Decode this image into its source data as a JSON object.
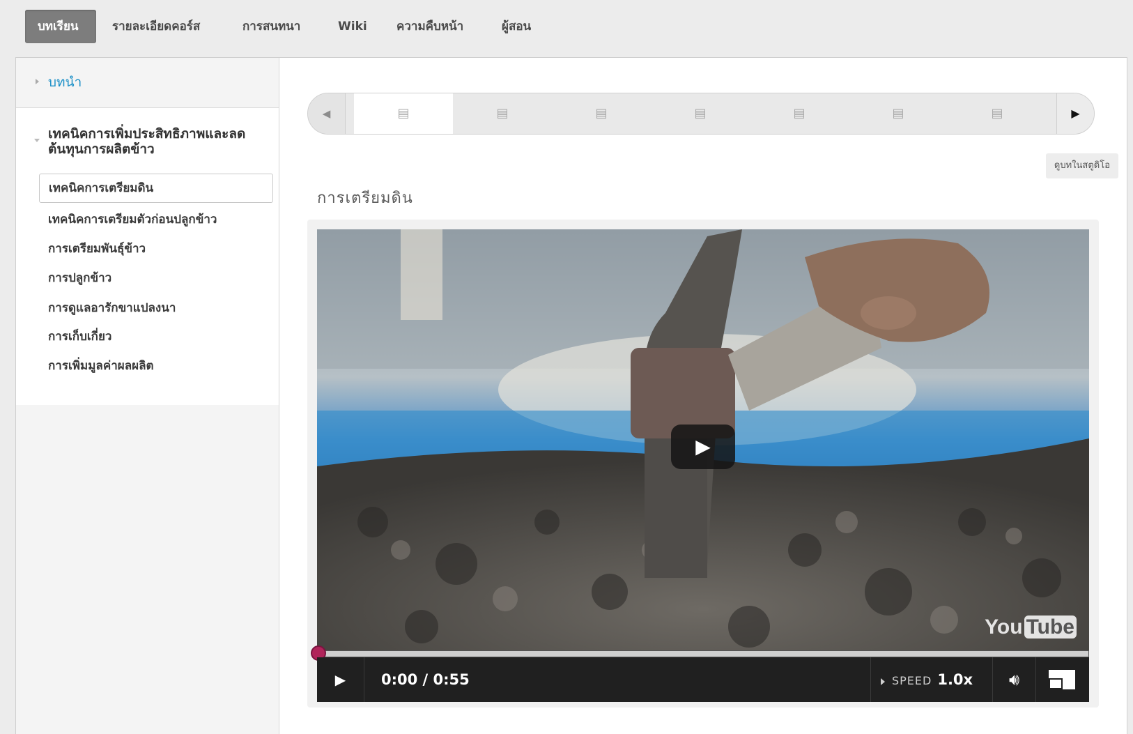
{
  "topnav": {
    "tabs": [
      {
        "label": "บทเรียน"
      },
      {
        "label": "รายละเอียดคอร์ส"
      },
      {
        "label": "การสนทนา"
      },
      {
        "label": "Wiki"
      },
      {
        "label": "ความคืบหน้า"
      },
      {
        "label": "ผู้สอน"
      }
    ],
    "active_index": 0
  },
  "sidebar": {
    "chapters": [
      {
        "label": "บทนำ",
        "expanded": false
      },
      {
        "label": "เทคนิคการเพิ่มประสิทธิภาพและลดต้นทุนการผลิตข้าว",
        "expanded": true
      }
    ],
    "lessons": [
      {
        "label": "เทคนิคการเตรียมดิน",
        "active": true
      },
      {
        "label": "เทคนิคการเตรียมตัวก่อนปลูกข้าว"
      },
      {
        "label": "การเตรียมพันธุ์ข้าว"
      },
      {
        "label": "การปลูกข้าว"
      },
      {
        "label": "การดูแลอารักขาแปลงนา"
      },
      {
        "label": "การเก็บเกี่ยว"
      },
      {
        "label": "การเพิ่มมูลค่าผลผลิต"
      }
    ]
  },
  "sequence_nav": {
    "prev_icon": "triangle-left-icon",
    "next_icon": "triangle-right-icon",
    "item_icon": "film-icon",
    "item_count": 7,
    "active_index": 0
  },
  "unit": {
    "bookmark_label": "ดูบทในสตูดิโอ",
    "title": "การเตรียมดิน"
  },
  "video": {
    "time": "0:00 / 0:55",
    "speed_label": "SPEED",
    "speed_value": "1.0x",
    "progress": 0,
    "logo_you": "You",
    "logo_tube": "Tube",
    "accent": "#b0245a"
  }
}
